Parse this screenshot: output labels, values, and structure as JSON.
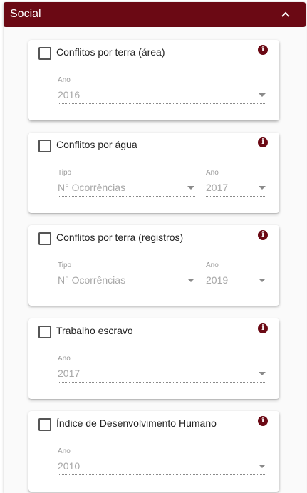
{
  "panel": {
    "title": "Social",
    "collapse_icon": "chevron-up-icon"
  },
  "colors": {
    "accent": "#6b0914",
    "muted_text": "#a8a8a8"
  },
  "cards": [
    {
      "title": "Conflitos por terra (área)",
      "ano_label": "Ano",
      "ano_value": "2016"
    },
    {
      "title": "Conflitos por água",
      "tipo_label": "Tipo",
      "tipo_value": "N° Ocorrências",
      "ano_label": "Ano",
      "ano_value": "2017"
    },
    {
      "title": "Conflitos por terra (registros)",
      "tipo_label": "Tipo",
      "tipo_value": "N° Ocorrências",
      "ano_label": "Ano",
      "ano_value": "2019"
    },
    {
      "title": "Trabalho escravo",
      "ano_label": "Ano",
      "ano_value": "2017"
    },
    {
      "title": "Índice de Desenvolvimento Humano",
      "ano_label": "Ano",
      "ano_value": "2010"
    }
  ]
}
